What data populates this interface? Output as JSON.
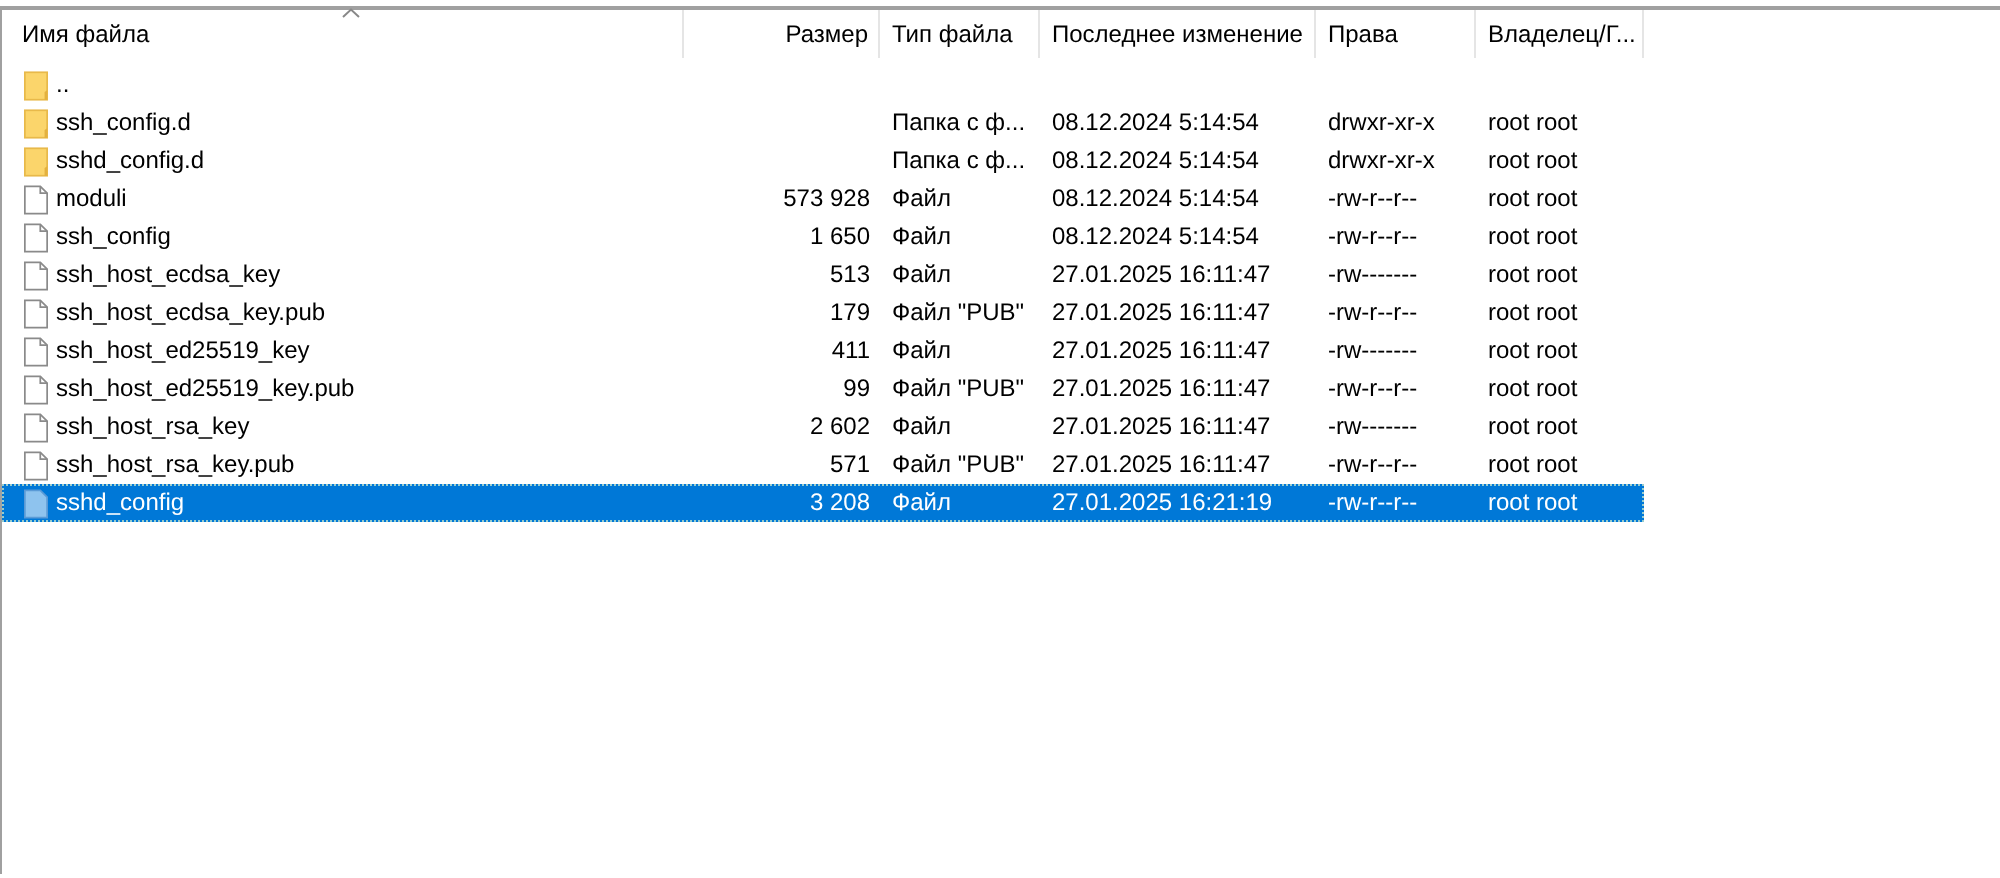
{
  "table": {
    "columns": [
      {
        "label": "Имя файла",
        "sorted": true
      },
      {
        "label": "Размер",
        "sorted": false
      },
      {
        "label": "Тип файла",
        "sorted": false
      },
      {
        "label": "Последнее изменение",
        "sorted": false
      },
      {
        "label": "Права",
        "sorted": false
      },
      {
        "label": "Владелец/Г...",
        "sorted": false
      }
    ],
    "rows": [
      {
        "kind": "folder",
        "name": "..",
        "size": "",
        "type": "",
        "modified": "",
        "rights": "",
        "owner": "",
        "selected": false
      },
      {
        "kind": "folder",
        "name": "ssh_config.d",
        "size": "",
        "type": "Папка с ф...",
        "modified": "08.12.2024 5:14:54",
        "rights": "drwxr-xr-x",
        "owner": "root root",
        "selected": false
      },
      {
        "kind": "folder",
        "name": "sshd_config.d",
        "size": "",
        "type": "Папка с ф...",
        "modified": "08.12.2024 5:14:54",
        "rights": "drwxr-xr-x",
        "owner": "root root",
        "selected": false
      },
      {
        "kind": "file",
        "name": "moduli",
        "size": "573 928",
        "type": "Файл",
        "modified": "08.12.2024 5:14:54",
        "rights": "-rw-r--r--",
        "owner": "root root",
        "selected": false
      },
      {
        "kind": "file",
        "name": "ssh_config",
        "size": "1 650",
        "type": "Файл",
        "modified": "08.12.2024 5:14:54",
        "rights": "-rw-r--r--",
        "owner": "root root",
        "selected": false
      },
      {
        "kind": "file",
        "name": "ssh_host_ecdsa_key",
        "size": "513",
        "type": "Файл",
        "modified": "27.01.2025 16:11:47",
        "rights": "-rw-------",
        "owner": "root root",
        "selected": false
      },
      {
        "kind": "file",
        "name": "ssh_host_ecdsa_key.pub",
        "size": "179",
        "type": "Файл \"PUB\"",
        "modified": "27.01.2025 16:11:47",
        "rights": "-rw-r--r--",
        "owner": "root root",
        "selected": false
      },
      {
        "kind": "file",
        "name": "ssh_host_ed25519_key",
        "size": "411",
        "type": "Файл",
        "modified": "27.01.2025 16:11:47",
        "rights": "-rw-------",
        "owner": "root root",
        "selected": false
      },
      {
        "kind": "file",
        "name": "ssh_host_ed25519_key.pub",
        "size": "99",
        "type": "Файл \"PUB\"",
        "modified": "27.01.2025 16:11:47",
        "rights": "-rw-r--r--",
        "owner": "root root",
        "selected": false
      },
      {
        "kind": "file",
        "name": "ssh_host_rsa_key",
        "size": "2 602",
        "type": "Файл",
        "modified": "27.01.2025 16:11:47",
        "rights": "-rw-------",
        "owner": "root root",
        "selected": false
      },
      {
        "kind": "file",
        "name": "ssh_host_rsa_key.pub",
        "size": "571",
        "type": "Файл \"PUB\"",
        "modified": "27.01.2025 16:11:47",
        "rights": "-rw-r--r--",
        "owner": "root root",
        "selected": false
      },
      {
        "kind": "file",
        "name": "sshd_config",
        "size": "3 208",
        "type": "Файл",
        "modified": "27.01.2025 16:21:19",
        "rights": "-rw-r--r--",
        "owner": "root root",
        "selected": true
      }
    ]
  }
}
